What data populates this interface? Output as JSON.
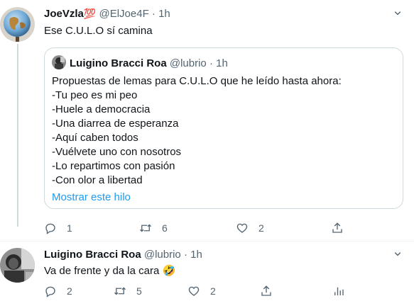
{
  "tweet1": {
    "name": "JoeVzla",
    "badge": "💯",
    "handle": "@ElJoe4F",
    "dot": "·",
    "time": "1h",
    "text": "Ese C.U.L.O sí camina",
    "quote": {
      "name": "Luigino Bracci Roa",
      "handle": "@lubrio",
      "dot": "·",
      "time": "1h",
      "lines": [
        "Propuestas de lemas para C.U.L.O que he leído hasta ahora:",
        "-Tu peo es mi peo",
        "-Huele a democracia",
        "-Una diarrea de esperanza",
        "-Aquí caben todos",
        "-Vuélvete uno con nosotros",
        "-Lo repartimos con pasión",
        "-Con olor a libertad"
      ],
      "show_thread": "Mostrar este hilo"
    },
    "actions": {
      "replies": "1",
      "retweets": "6",
      "likes": "2"
    }
  },
  "tweet2": {
    "name": "Luigino Bracci Roa",
    "handle": "@lubrio",
    "dot": "·",
    "time": "1h",
    "text": "Va de frente y da la cara",
    "emoji": "🤣",
    "actions": {
      "replies": "2",
      "retweets": "5",
      "likes": "2"
    }
  },
  "icons": {
    "more": "more-icon",
    "reply": "reply-icon",
    "retweet": "retweet-icon",
    "like": "heart-icon",
    "share": "share-icon",
    "analytics": "analytics-icon"
  },
  "colors": {
    "text": "#0f1419",
    "muted": "#536471",
    "link": "#1d9bf0",
    "border": "#cfd9de"
  }
}
